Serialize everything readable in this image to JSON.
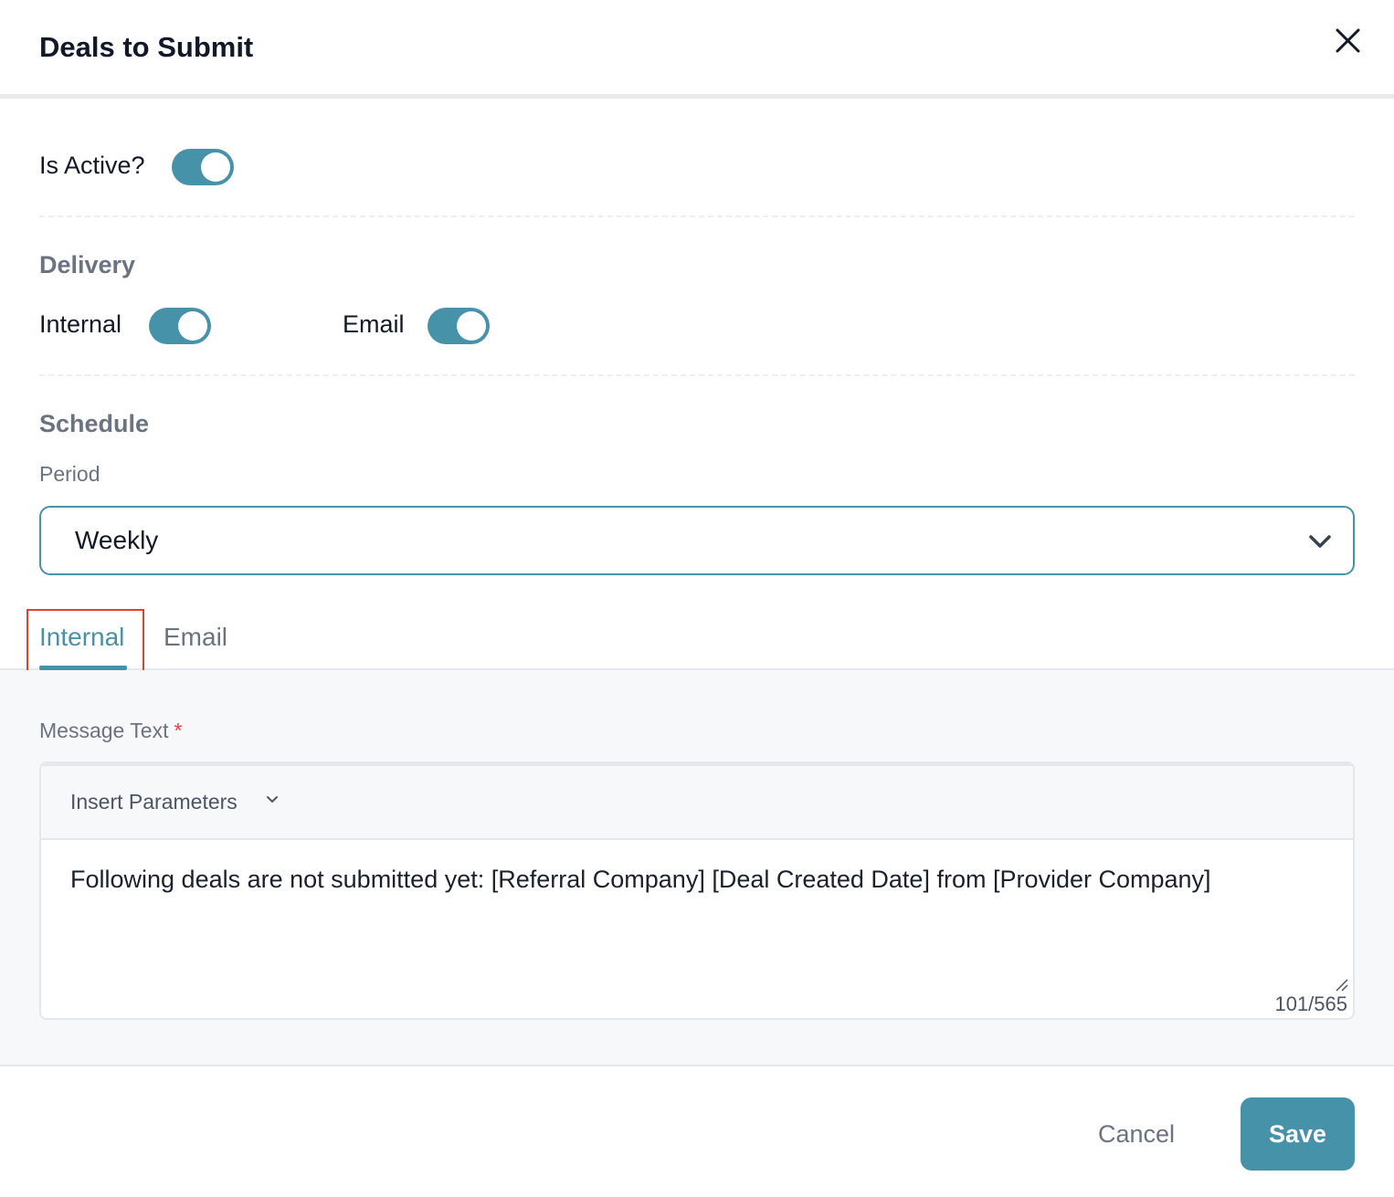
{
  "dialog": {
    "title": "Deals to Submit",
    "close_icon": "close-icon"
  },
  "is_active": {
    "label": "Is Active?",
    "on": true
  },
  "delivery": {
    "section_title": "Delivery",
    "internal": {
      "label": "Internal",
      "on": true
    },
    "email": {
      "label": "Email",
      "on": true
    }
  },
  "schedule": {
    "section_title": "Schedule",
    "period_label": "Period",
    "period_value": "Weekly"
  },
  "tabs": [
    {
      "label": "Internal",
      "active": true
    },
    {
      "label": "Email",
      "active": false
    }
  ],
  "message": {
    "label": "Message Text",
    "required_mark": "*",
    "toolbar_label": "Insert Parameters",
    "text": "Following deals are not submitted yet: [Referral Company] [Deal Created Date] from [Provider Company]",
    "counter": "101/565"
  },
  "footer": {
    "cancel_label": "Cancel",
    "save_label": "Save"
  },
  "colors": {
    "accent": "#4692a8",
    "highlight": "#e2412b",
    "required": "#e53e3e"
  }
}
